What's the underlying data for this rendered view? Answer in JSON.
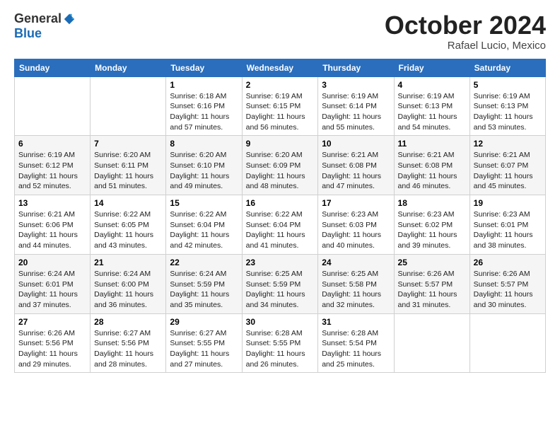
{
  "logo": {
    "general": "General",
    "blue": "Blue"
  },
  "title": "October 2024",
  "location": "Rafael Lucio, Mexico",
  "days_of_week": [
    "Sunday",
    "Monday",
    "Tuesday",
    "Wednesday",
    "Thursday",
    "Friday",
    "Saturday"
  ],
  "weeks": [
    [
      {
        "day": "",
        "sunrise": "",
        "sunset": "",
        "daylight": ""
      },
      {
        "day": "",
        "sunrise": "",
        "sunset": "",
        "daylight": ""
      },
      {
        "day": "1",
        "sunrise": "Sunrise: 6:18 AM",
        "sunset": "Sunset: 6:16 PM",
        "daylight": "Daylight: 11 hours and 57 minutes."
      },
      {
        "day": "2",
        "sunrise": "Sunrise: 6:19 AM",
        "sunset": "Sunset: 6:15 PM",
        "daylight": "Daylight: 11 hours and 56 minutes."
      },
      {
        "day": "3",
        "sunrise": "Sunrise: 6:19 AM",
        "sunset": "Sunset: 6:14 PM",
        "daylight": "Daylight: 11 hours and 55 minutes."
      },
      {
        "day": "4",
        "sunrise": "Sunrise: 6:19 AM",
        "sunset": "Sunset: 6:13 PM",
        "daylight": "Daylight: 11 hours and 54 minutes."
      },
      {
        "day": "5",
        "sunrise": "Sunrise: 6:19 AM",
        "sunset": "Sunset: 6:13 PM",
        "daylight": "Daylight: 11 hours and 53 minutes."
      }
    ],
    [
      {
        "day": "6",
        "sunrise": "Sunrise: 6:19 AM",
        "sunset": "Sunset: 6:12 PM",
        "daylight": "Daylight: 11 hours and 52 minutes."
      },
      {
        "day": "7",
        "sunrise": "Sunrise: 6:20 AM",
        "sunset": "Sunset: 6:11 PM",
        "daylight": "Daylight: 11 hours and 51 minutes."
      },
      {
        "day": "8",
        "sunrise": "Sunrise: 6:20 AM",
        "sunset": "Sunset: 6:10 PM",
        "daylight": "Daylight: 11 hours and 49 minutes."
      },
      {
        "day": "9",
        "sunrise": "Sunrise: 6:20 AM",
        "sunset": "Sunset: 6:09 PM",
        "daylight": "Daylight: 11 hours and 48 minutes."
      },
      {
        "day": "10",
        "sunrise": "Sunrise: 6:21 AM",
        "sunset": "Sunset: 6:08 PM",
        "daylight": "Daylight: 11 hours and 47 minutes."
      },
      {
        "day": "11",
        "sunrise": "Sunrise: 6:21 AM",
        "sunset": "Sunset: 6:08 PM",
        "daylight": "Daylight: 11 hours and 46 minutes."
      },
      {
        "day": "12",
        "sunrise": "Sunrise: 6:21 AM",
        "sunset": "Sunset: 6:07 PM",
        "daylight": "Daylight: 11 hours and 45 minutes."
      }
    ],
    [
      {
        "day": "13",
        "sunrise": "Sunrise: 6:21 AM",
        "sunset": "Sunset: 6:06 PM",
        "daylight": "Daylight: 11 hours and 44 minutes."
      },
      {
        "day": "14",
        "sunrise": "Sunrise: 6:22 AM",
        "sunset": "Sunset: 6:05 PM",
        "daylight": "Daylight: 11 hours and 43 minutes."
      },
      {
        "day": "15",
        "sunrise": "Sunrise: 6:22 AM",
        "sunset": "Sunset: 6:04 PM",
        "daylight": "Daylight: 11 hours and 42 minutes."
      },
      {
        "day": "16",
        "sunrise": "Sunrise: 6:22 AM",
        "sunset": "Sunset: 6:04 PM",
        "daylight": "Daylight: 11 hours and 41 minutes."
      },
      {
        "day": "17",
        "sunrise": "Sunrise: 6:23 AM",
        "sunset": "Sunset: 6:03 PM",
        "daylight": "Daylight: 11 hours and 40 minutes."
      },
      {
        "day": "18",
        "sunrise": "Sunrise: 6:23 AM",
        "sunset": "Sunset: 6:02 PM",
        "daylight": "Daylight: 11 hours and 39 minutes."
      },
      {
        "day": "19",
        "sunrise": "Sunrise: 6:23 AM",
        "sunset": "Sunset: 6:01 PM",
        "daylight": "Daylight: 11 hours and 38 minutes."
      }
    ],
    [
      {
        "day": "20",
        "sunrise": "Sunrise: 6:24 AM",
        "sunset": "Sunset: 6:01 PM",
        "daylight": "Daylight: 11 hours and 37 minutes."
      },
      {
        "day": "21",
        "sunrise": "Sunrise: 6:24 AM",
        "sunset": "Sunset: 6:00 PM",
        "daylight": "Daylight: 11 hours and 36 minutes."
      },
      {
        "day": "22",
        "sunrise": "Sunrise: 6:24 AM",
        "sunset": "Sunset: 5:59 PM",
        "daylight": "Daylight: 11 hours and 35 minutes."
      },
      {
        "day": "23",
        "sunrise": "Sunrise: 6:25 AM",
        "sunset": "Sunset: 5:59 PM",
        "daylight": "Daylight: 11 hours and 34 minutes."
      },
      {
        "day": "24",
        "sunrise": "Sunrise: 6:25 AM",
        "sunset": "Sunset: 5:58 PM",
        "daylight": "Daylight: 11 hours and 32 minutes."
      },
      {
        "day": "25",
        "sunrise": "Sunrise: 6:26 AM",
        "sunset": "Sunset: 5:57 PM",
        "daylight": "Daylight: 11 hours and 31 minutes."
      },
      {
        "day": "26",
        "sunrise": "Sunrise: 6:26 AM",
        "sunset": "Sunset: 5:57 PM",
        "daylight": "Daylight: 11 hours and 30 minutes."
      }
    ],
    [
      {
        "day": "27",
        "sunrise": "Sunrise: 6:26 AM",
        "sunset": "Sunset: 5:56 PM",
        "daylight": "Daylight: 11 hours and 29 minutes."
      },
      {
        "day": "28",
        "sunrise": "Sunrise: 6:27 AM",
        "sunset": "Sunset: 5:56 PM",
        "daylight": "Daylight: 11 hours and 28 minutes."
      },
      {
        "day": "29",
        "sunrise": "Sunrise: 6:27 AM",
        "sunset": "Sunset: 5:55 PM",
        "daylight": "Daylight: 11 hours and 27 minutes."
      },
      {
        "day": "30",
        "sunrise": "Sunrise: 6:28 AM",
        "sunset": "Sunset: 5:55 PM",
        "daylight": "Daylight: 11 hours and 26 minutes."
      },
      {
        "day": "31",
        "sunrise": "Sunrise: 6:28 AM",
        "sunset": "Sunset: 5:54 PM",
        "daylight": "Daylight: 11 hours and 25 minutes."
      },
      {
        "day": "",
        "sunrise": "",
        "sunset": "",
        "daylight": ""
      },
      {
        "day": "",
        "sunrise": "",
        "sunset": "",
        "daylight": ""
      }
    ]
  ]
}
